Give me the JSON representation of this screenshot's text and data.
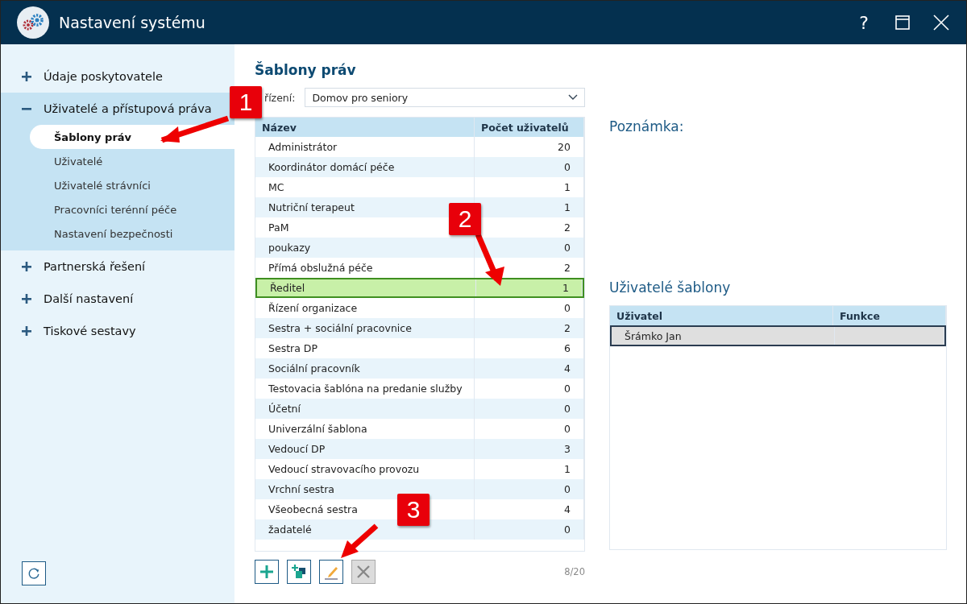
{
  "window": {
    "title": "Nastavení systému",
    "controls": [
      {
        "kind": "help",
        "label": "?"
      },
      {
        "kind": "maximize"
      },
      {
        "kind": "close"
      }
    ]
  },
  "sidebar": {
    "items": [
      {
        "label": "Údaje poskytovatele",
        "expanded": false
      },
      {
        "label": "Uživatelé a přístupová práva",
        "expanded": true,
        "children": [
          {
            "label": "Šablony práv",
            "selected": true
          },
          {
            "label": "Uživatelé",
            "selected": false
          },
          {
            "label": "Uživatelé strávníci",
            "selected": false
          },
          {
            "label": "Pracovníci terénní péče",
            "selected": false
          },
          {
            "label": "Nastavení bezpečnosti",
            "selected": false
          }
        ]
      },
      {
        "label": "Partnerská řešení",
        "expanded": false
      },
      {
        "label": "Další nastavení",
        "expanded": false
      },
      {
        "label": "Tiskové sestavy",
        "expanded": false
      }
    ]
  },
  "main": {
    "title": "Šablony práv",
    "facility": {
      "label": "řízení:",
      "value": "Domov pro seniory"
    },
    "table": {
      "columns": [
        "Název",
        "Počet uživatelů"
      ],
      "rows": [
        {
          "name": "Administrátor",
          "count": "20",
          "selected": false
        },
        {
          "name": "Koordinátor domácí péče",
          "count": "0",
          "selected": false
        },
        {
          "name": "MC",
          "count": "1",
          "selected": false
        },
        {
          "name": "Nutriční terapeut",
          "count": "1",
          "selected": false
        },
        {
          "name": "PaM",
          "count": "2",
          "selected": false
        },
        {
          "name": "poukazy",
          "count": "0",
          "selected": false
        },
        {
          "name": "Přímá obslužná péče",
          "count": "2",
          "selected": false
        },
        {
          "name": "Ředitel",
          "count": "1",
          "selected": true
        },
        {
          "name": "Řízení organizace",
          "count": "0",
          "selected": false
        },
        {
          "name": "Sestra + sociální pracovnice",
          "count": "2",
          "selected": false
        },
        {
          "name": "Sestra DP",
          "count": "6",
          "selected": false
        },
        {
          "name": "Sociální pracovník",
          "count": "4",
          "selected": false
        },
        {
          "name": "Testovacia šablóna na predanie služby",
          "count": "0",
          "selected": false
        },
        {
          "name": "Účetní",
          "count": "0",
          "selected": false
        },
        {
          "name": "Univerzální šablona",
          "count": "0",
          "selected": false
        },
        {
          "name": "Vedoucí DP",
          "count": "3",
          "selected": false
        },
        {
          "name": "Vedoucí stravovacího provozu",
          "count": "1",
          "selected": false
        },
        {
          "name": "Vrchní sestra",
          "count": "0",
          "selected": false
        },
        {
          "name": "Všeobecná sestra",
          "count": "4",
          "selected": false
        },
        {
          "name": "žadatelé",
          "count": "0",
          "selected": false
        }
      ]
    },
    "toolbar": [
      {
        "kind": "add",
        "disabled": false
      },
      {
        "kind": "copy",
        "disabled": false
      },
      {
        "kind": "edit",
        "disabled": false
      },
      {
        "kind": "delete",
        "disabled": true
      }
    ],
    "counter": "8/20"
  },
  "details": {
    "note_label": "Poznámka:",
    "users_title": "Uživatelé šablony",
    "users_table": {
      "columns": [
        "Uživatel",
        "Funkce"
      ],
      "rows": [
        {
          "user": "Šrámko Jan",
          "selected": true
        }
      ]
    }
  },
  "callouts": [
    {
      "label": "1"
    },
    {
      "label": "2"
    },
    {
      "label": "3"
    }
  ]
}
